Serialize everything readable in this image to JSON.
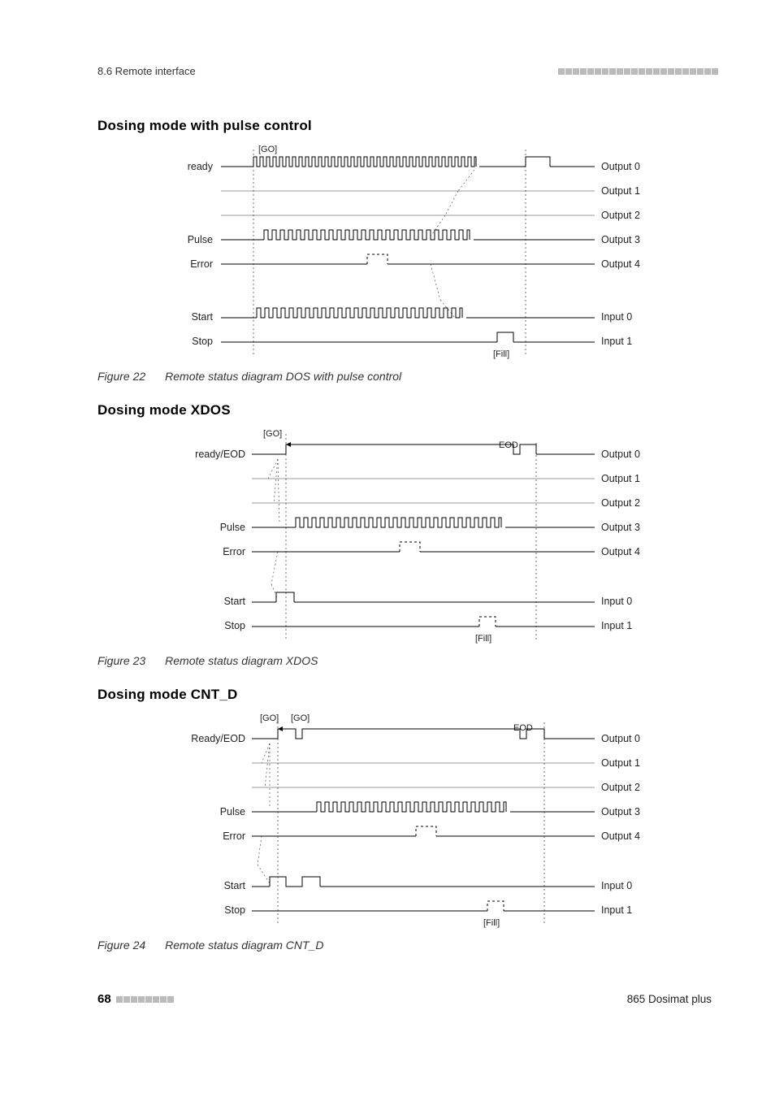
{
  "header": {
    "section": "8.6 Remote interface"
  },
  "footer": {
    "page_num": "68",
    "doc_title": "865 Dosimat plus"
  },
  "sections": [
    {
      "heading": "Dosing mode with pulse control",
      "fig_label": "Figure 22",
      "fig_caption": "Remote status diagram DOS with pulse control"
    },
    {
      "heading": "Dosing mode XDOS",
      "fig_label": "Figure 23",
      "fig_caption": "Remote status diagram XDOS"
    },
    {
      "heading": "Dosing mode CNT_D",
      "fig_label": "Figure 24",
      "fig_caption": "Remote status diagram CNT_D"
    }
  ],
  "chart_data": [
    {
      "type": "timing-diagram",
      "annotations": [
        "[GO]",
        "[Fill]"
      ],
      "left_labels": [
        "ready",
        "Pulse",
        "Error",
        "Start",
        "Stop"
      ],
      "right_labels": [
        "Output 0",
        "Output 1",
        "Output 2",
        "Output 3",
        "Output 4",
        "Input 0",
        "Input 1"
      ],
      "signals": {
        "ready": "low → pulse-train (GO goes high) → low after last pulse",
        "pulse": "low → pulse-train coincident with ready → low",
        "error": "low → brief high pulse mid-sequence → low",
        "start": "low → pulse-train coincident with ready (input) → low",
        "stop": "low → short high pulse at end (Fill) then low"
      }
    },
    {
      "type": "timing-diagram",
      "annotations": [
        "[GO]",
        "EOD",
        "[Fill]"
      ],
      "left_labels": [
        "ready/EOD",
        "Pulse",
        "Error",
        "Start",
        "Stop"
      ],
      "right_labels": [
        "Output 0",
        "Output 1",
        "Output 2",
        "Output 3",
        "Output 4",
        "Input 0",
        "Input 1"
      ],
      "signals": {
        "ready_eod": "low → high (GO) steady → short low-high-low EOD notch near end → low",
        "pulse": "low → pulse-train during high segment → low",
        "error": "low → short high pulse mid-sequence → low",
        "start": "low → short high pulse at GO → low",
        "stop": "low → short high pulse at Fill → low"
      }
    },
    {
      "type": "timing-diagram",
      "annotations": [
        "[GO]",
        "[GO]",
        "EOD",
        "[Fill]"
      ],
      "left_labels": [
        "Ready/EOD",
        "Pulse",
        "Error",
        "Start",
        "Stop"
      ],
      "right_labels": [
        "Output 0",
        "Output 1",
        "Output 2",
        "Output 3",
        "Output 4",
        "Input 0",
        "Input 1"
      ],
      "signals": {
        "ready_eod": "low → high (GO) → low notch → high again (second GO) steady → EOD notch near end → low",
        "pulse": "low → pulse-train during second steady high → low",
        "error": "low → short high pulse mid-sequence → low",
        "start": "low → two short high pulses (at each GO) → low",
        "stop": "low → short high pulse at Fill → low"
      }
    }
  ]
}
